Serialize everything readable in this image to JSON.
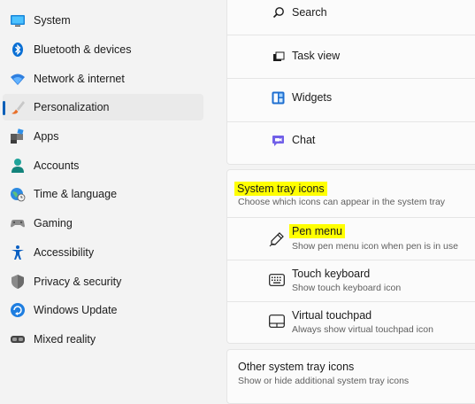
{
  "sidebar": {
    "items": [
      {
        "label": "System",
        "icon": "system-icon",
        "selected": false
      },
      {
        "label": "Bluetooth & devices",
        "icon": "bluetooth-icon",
        "selected": false
      },
      {
        "label": "Network & internet",
        "icon": "wifi-icon",
        "selected": false
      },
      {
        "label": "Personalization",
        "icon": "brush-icon",
        "selected": true
      },
      {
        "label": "Apps",
        "icon": "apps-icon",
        "selected": false
      },
      {
        "label": "Accounts",
        "icon": "person-icon",
        "selected": false
      },
      {
        "label": "Time & language",
        "icon": "globe-clock-icon",
        "selected": false
      },
      {
        "label": "Gaming",
        "icon": "controller-icon",
        "selected": false
      },
      {
        "label": "Accessibility",
        "icon": "accessibility-icon",
        "selected": false
      },
      {
        "label": "Privacy & security",
        "icon": "shield-icon",
        "selected": false
      },
      {
        "label": "Windows Update",
        "icon": "update-icon",
        "selected": false
      },
      {
        "label": "Mixed reality",
        "icon": "headset-icon",
        "selected": false
      }
    ]
  },
  "taskbar_items": {
    "search": "Search",
    "task_view": "Task view",
    "widgets": "Widgets",
    "chat": "Chat"
  },
  "system_tray": {
    "title": "System tray icons",
    "subtitle": "Choose which icons can appear in the system tray",
    "pen_menu": {
      "label": "Pen menu",
      "desc": "Show pen menu icon when pen is in use"
    },
    "touch_keyboard": {
      "label": "Touch keyboard",
      "desc": "Show touch keyboard icon"
    },
    "virtual_touchpad": {
      "label": "Virtual touchpad",
      "desc": "Always show virtual touchpad icon"
    }
  },
  "other_tray": {
    "label": "Other system tray icons",
    "desc": "Show or hide additional system tray icons"
  },
  "colors": {
    "accent": "#005fb8",
    "highlight": "#ffff00"
  }
}
